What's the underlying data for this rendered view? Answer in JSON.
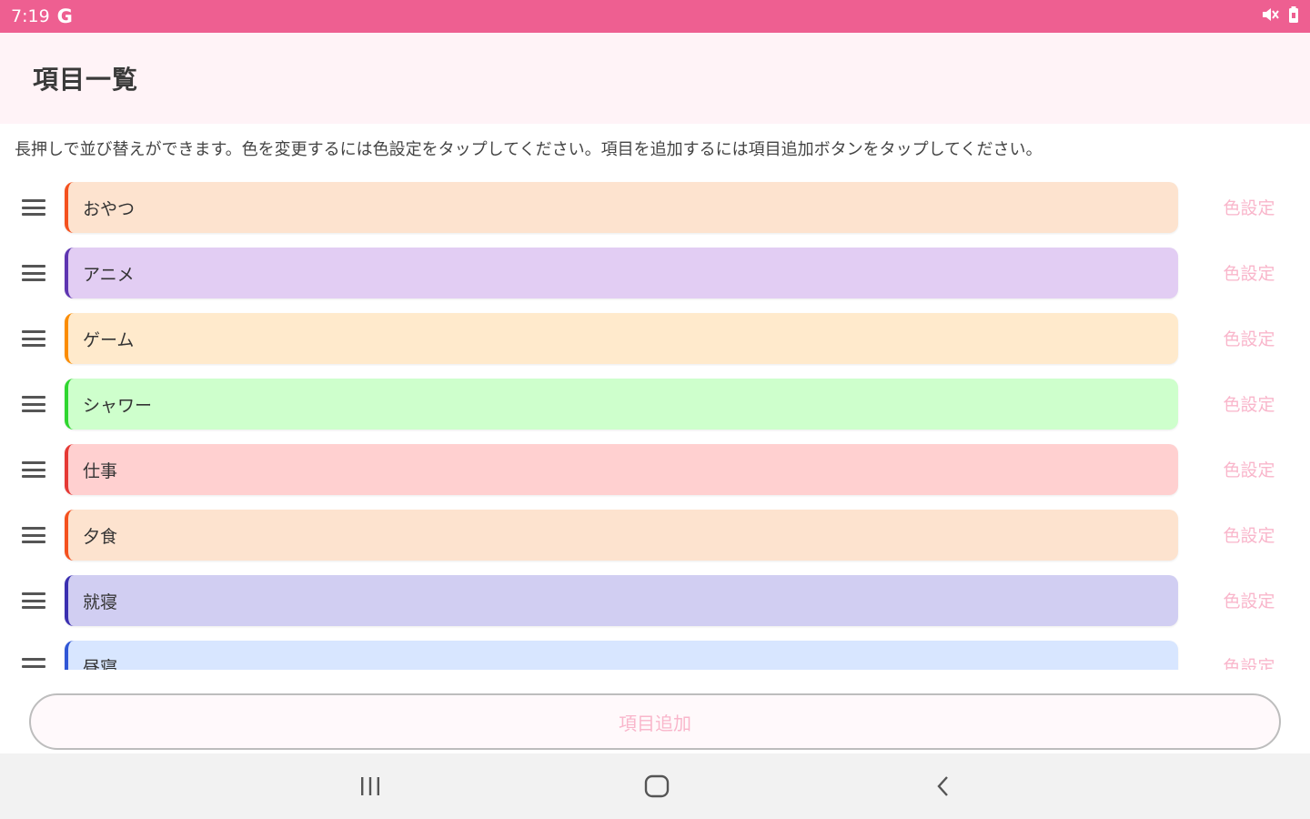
{
  "status_bar": {
    "time": "7:19",
    "google_glyph": "G",
    "icons": [
      "google-icon",
      "mute-icon",
      "battery-icon"
    ]
  },
  "app_bar": {
    "title": "項目一覧"
  },
  "instructions": "長押しで並び替えができます。色を変更するには色設定をタップしてください。項目を追加するには項目追加ボタンをタップしてください。",
  "items": [
    {
      "label": "おやつ",
      "bg": "#fde3cf",
      "accent": "#f4511e",
      "color_button": "色設定"
    },
    {
      "label": "アニメ",
      "bg": "#e2cdf3",
      "accent": "#5e35b1",
      "color_button": "色設定"
    },
    {
      "label": "ゲーム",
      "bg": "#ffeacc",
      "accent": "#fb8c00",
      "color_button": "色設定"
    },
    {
      "label": "シャワー",
      "bg": "#ceffcc",
      "accent": "#2fd62f",
      "color_button": "色設定"
    },
    {
      "label": "仕事",
      "bg": "#ffd0d0",
      "accent": "#e53935",
      "color_button": "色設定"
    },
    {
      "label": "夕食",
      "bg": "#fde3cf",
      "accent": "#f4511e",
      "color_button": "色設定"
    },
    {
      "label": "就寝",
      "bg": "#d1cef2",
      "accent": "#3a2fb0",
      "color_button": "色設定"
    },
    {
      "label": "昼寝",
      "bg": "#d8e6ff",
      "accent": "#3057d6",
      "color_button": "色設定"
    }
  ],
  "add_button": {
    "label": "項目追加"
  },
  "nav_bar": {
    "recents": "recents-icon",
    "home": "home-icon",
    "back": "back-icon"
  },
  "colors": {
    "status_bar": "#ee5f91",
    "app_bar": "#fff3f7",
    "accent_text": "#f9b6cb"
  }
}
